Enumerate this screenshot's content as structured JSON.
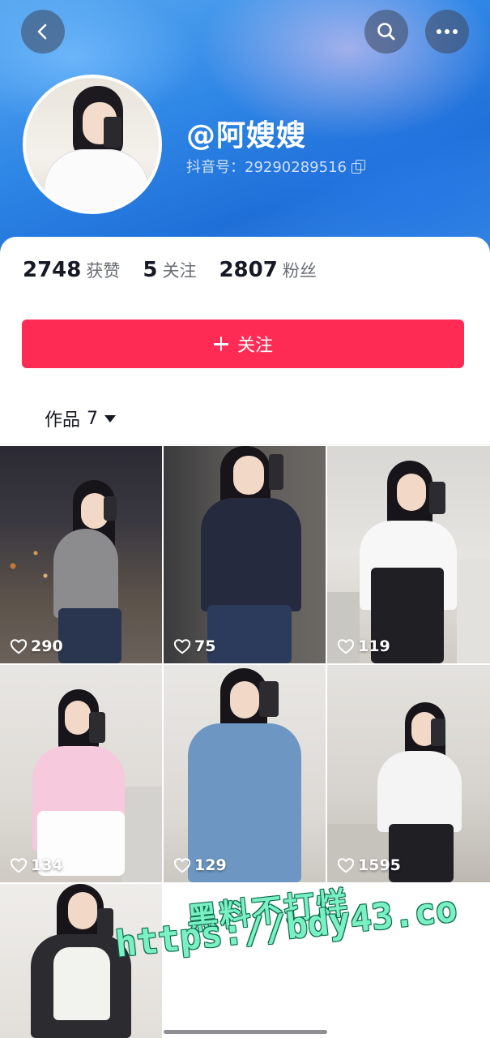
{
  "header": {
    "back_icon": "chevron-left-icon",
    "search_icon": "search-icon",
    "more_icon": "more-horizontal-icon",
    "colors": {
      "banner": "#2f87e6",
      "button_bg": "rgba(60,70,90,0.55)"
    }
  },
  "profile": {
    "username": "@阿嫂嫂",
    "douyin_id": "抖音号：29290289516",
    "copy_icon": "copy-icon"
  },
  "stats": [
    {
      "value": "2748",
      "label": "获赞"
    },
    {
      "value": "5",
      "label": "关注"
    },
    {
      "value": "2807",
      "label": "粉丝"
    }
  ],
  "follow_button": {
    "label": "关注",
    "color": "#fe2c55"
  },
  "works_tab": {
    "label": "作品",
    "count": "7",
    "caret_icon": "caret-down-icon"
  },
  "videos": [
    {
      "likes": "290"
    },
    {
      "likes": "75"
    },
    {
      "likes": "119"
    },
    {
      "likes": "134"
    },
    {
      "likes": "129"
    },
    {
      "likes": "1595"
    },
    {
      "likes": ""
    }
  ],
  "watermark": {
    "line1": "黑料不打烊",
    "line2": "https://bdy43.co"
  }
}
